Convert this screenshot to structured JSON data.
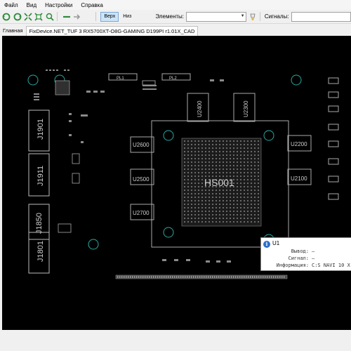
{
  "menu": {
    "items": [
      "Файл",
      "Вид",
      "Настройки",
      "Справка"
    ]
  },
  "toolbar": {
    "side_top": "Верх",
    "side_bottom": "Низ",
    "elements_label": "Элементы:",
    "signals_label": "Сигналы:"
  },
  "tabs": {
    "home": "Главная",
    "file": "FixDevice.NET_TUF 3 RX5700XT-O8G-GAMING D199PI r1.01X_CAD"
  },
  "board": {
    "labels": {
      "j1901": "J1901",
      "j1911": "J1911",
      "j1850": "J1850",
      "j1801": "J1801",
      "u2600": "U2600",
      "u2500": "U2500",
      "u2700": "U2700",
      "u2400": "U2400",
      "u2300": "U2300",
      "u2200": "U2200",
      "u2100": "U2100",
      "hs001": "HS001",
      "pl1": "PL1",
      "pl2": "PL2"
    }
  },
  "popup": {
    "title": "U1",
    "output_key": "Вывод:",
    "output_val": "—",
    "signal_key": "Сигнал:",
    "signal_val": "—",
    "info_key": "Информация:",
    "info_val": "C:S NAVI 10 X"
  },
  "colors": {
    "board_bg": "#000000",
    "silkscreen": "#c8c8c8",
    "pad": "#9a9a9a",
    "via_ring": "#2aa8a0",
    "accent": "#2f6fc9"
  }
}
